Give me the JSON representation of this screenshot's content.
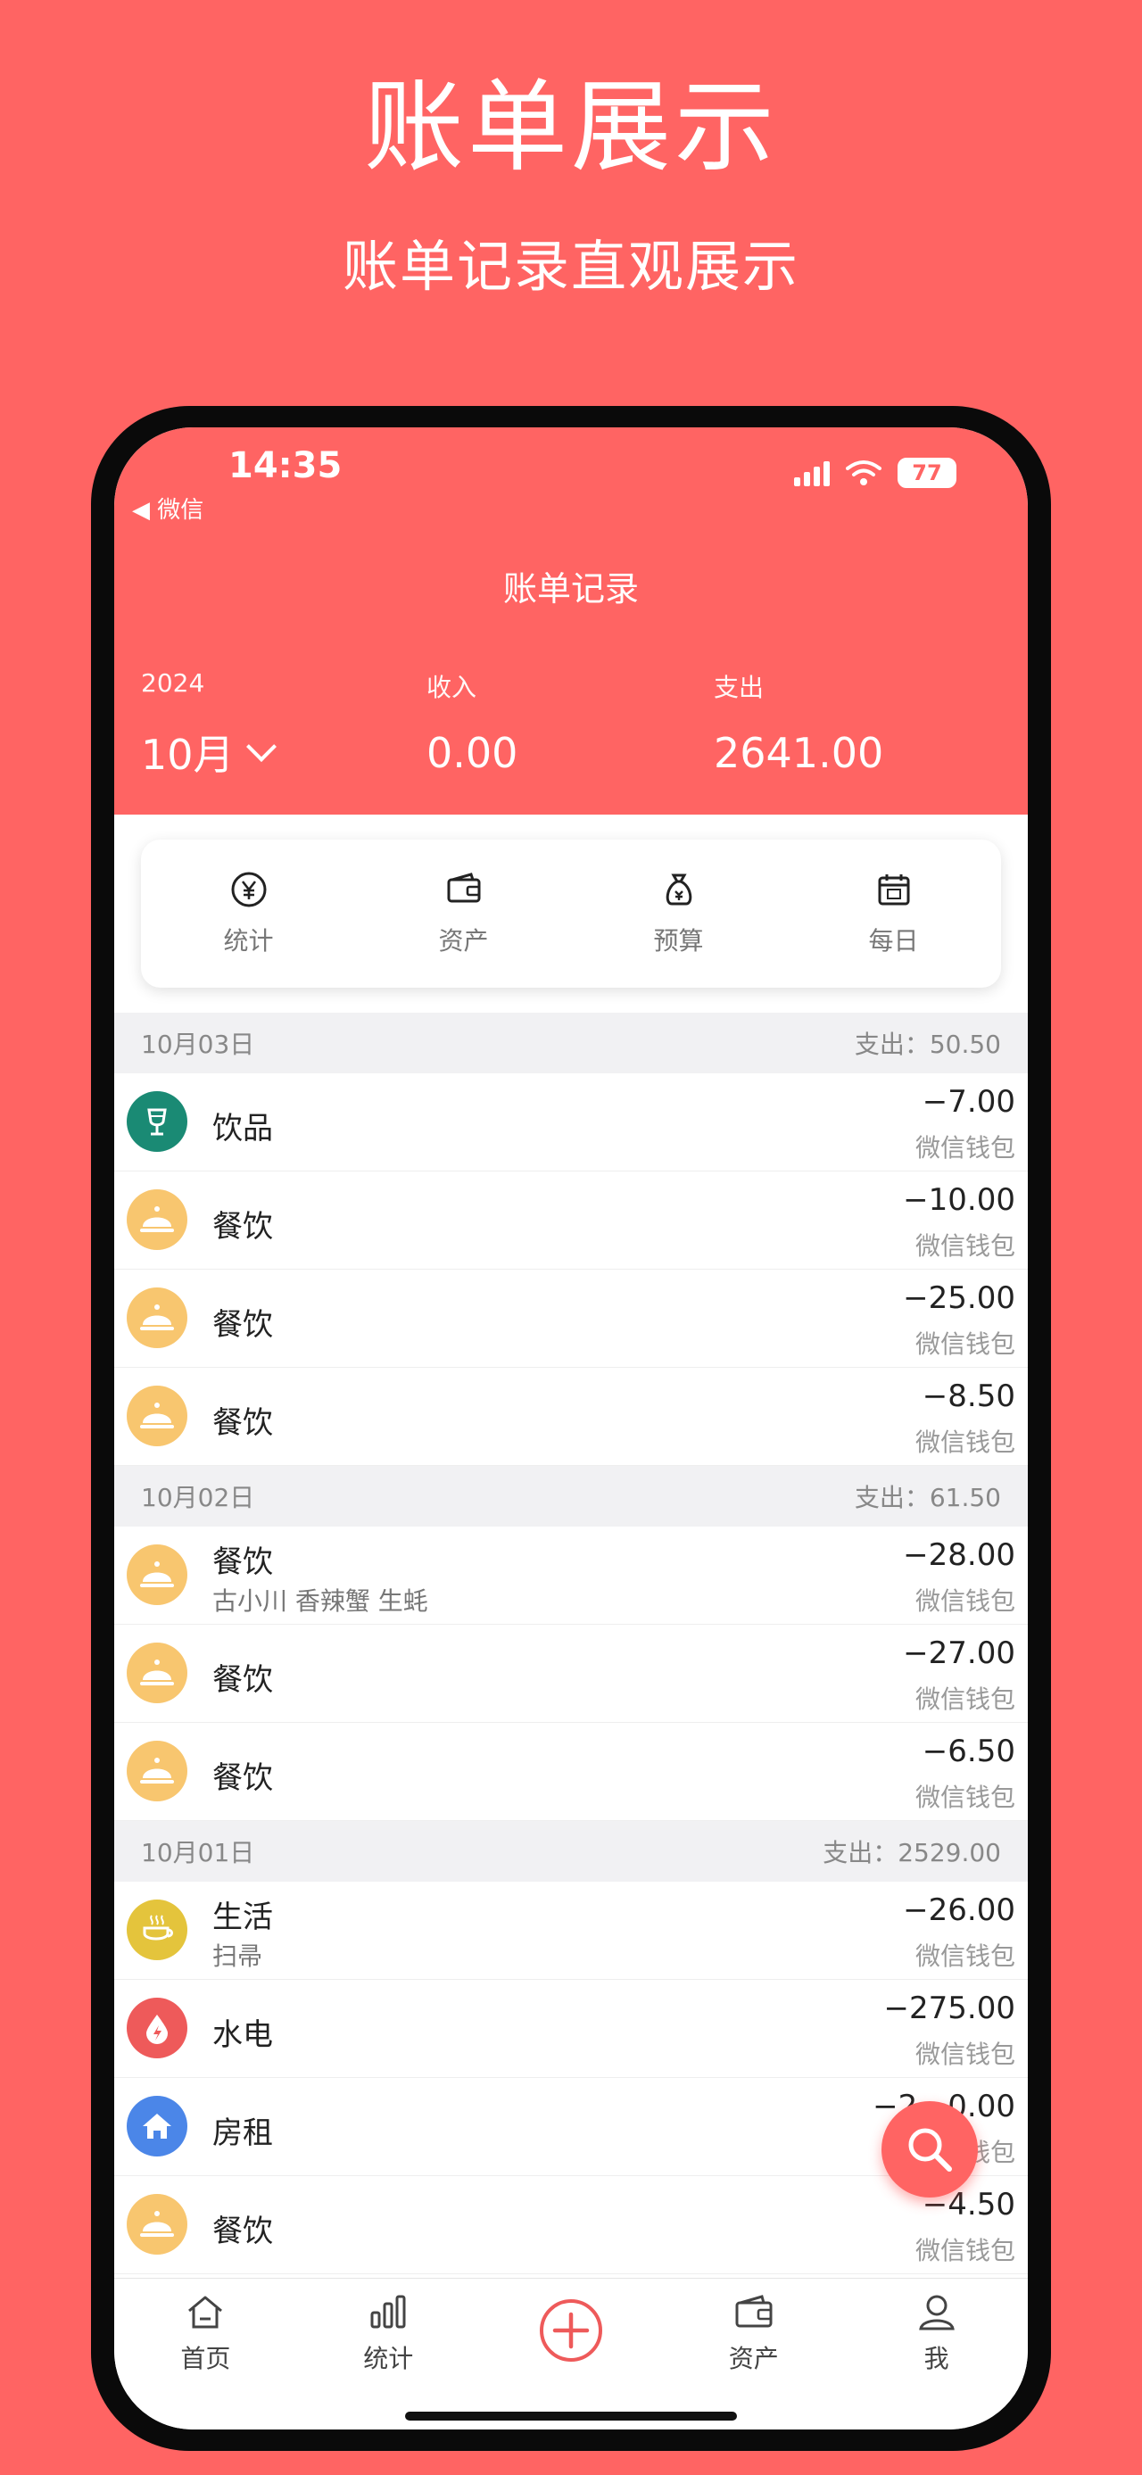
{
  "promo": {
    "title": "账单展示",
    "subtitle": "账单记录直观展示"
  },
  "status": {
    "time": "14:35",
    "back_label": "◀ 微信",
    "battery": "77"
  },
  "nav": {
    "title": "账单记录"
  },
  "summary": {
    "year": "2024",
    "month": "10月",
    "income_label": "收入",
    "income_value": "0.00",
    "expense_label": "支出",
    "expense_value": "2641.00"
  },
  "quick": [
    {
      "label": "统计",
      "icon": "yen-circle-icon"
    },
    {
      "label": "资产",
      "icon": "wallet-icon"
    },
    {
      "label": "预算",
      "icon": "money-bag-icon"
    },
    {
      "label": "每日",
      "icon": "calendar-icon"
    }
  ],
  "days": [
    {
      "date": "10月03日",
      "total": "支出：50.50",
      "items": [
        {
          "category": "饮品",
          "note": "",
          "amount": "−7.00",
          "account": "微信钱包",
          "icon": "drink-icon",
          "color": "#1A8A74"
        },
        {
          "category": "餐饮",
          "note": "",
          "amount": "−10.00",
          "account": "微信钱包",
          "icon": "dining-cloche-icon",
          "color": "#F8C66F"
        },
        {
          "category": "餐饮",
          "note": "",
          "amount": "−25.00",
          "account": "微信钱包",
          "icon": "dining-cloche-icon",
          "color": "#F8C66F"
        },
        {
          "category": "餐饮",
          "note": "",
          "amount": "−8.50",
          "account": "微信钱包",
          "icon": "dining-cloche-icon",
          "color": "#F8C66F"
        }
      ]
    },
    {
      "date": "10月02日",
      "total": "支出：61.50",
      "items": [
        {
          "category": "餐饮",
          "note": "古小川 香辣蟹 生蚝",
          "amount": "−28.00",
          "account": "微信钱包",
          "icon": "dining-cloche-icon",
          "color": "#F8C66F"
        },
        {
          "category": "餐饮",
          "note": "",
          "amount": "−27.00",
          "account": "微信钱包",
          "icon": "dining-cloche-icon",
          "color": "#F8C66F"
        },
        {
          "category": "餐饮",
          "note": "",
          "amount": "−6.50",
          "account": "微信钱包",
          "icon": "dining-cloche-icon",
          "color": "#F8C66F"
        }
      ]
    },
    {
      "date": "10月01日",
      "total": "支出：2529.00",
      "items": [
        {
          "category": "生活",
          "note": "扫帚",
          "amount": "−26.00",
          "account": "微信钱包",
          "icon": "coffee-cup-icon",
          "color": "#E4C43C"
        },
        {
          "category": "水电",
          "note": "",
          "amount": "−275.00",
          "account": "微信钱包",
          "icon": "utility-drop-icon",
          "color": "#EE5A5A"
        },
        {
          "category": "房租",
          "note": "",
          "amount": "−2…0.00",
          "account": "微信钱包",
          "icon": "house-icon",
          "color": "#4B86E8"
        },
        {
          "category": "餐饮",
          "note": "",
          "amount": "−4.50",
          "account": "微信钱包",
          "icon": "dining-cloche-icon",
          "color": "#F8C66F"
        }
      ]
    }
  ],
  "tabs": [
    {
      "label": "首页",
      "icon": "home-icon"
    },
    {
      "label": "统计",
      "icon": "bar-chart-icon"
    },
    {
      "label": "",
      "icon": "add-circle-icon"
    },
    {
      "label": "资产",
      "icon": "wallet-icon"
    },
    {
      "label": "我",
      "icon": "user-icon"
    }
  ],
  "colors": {
    "brand": "#FF6463",
    "list_header_bg": "#F1F1F3"
  }
}
